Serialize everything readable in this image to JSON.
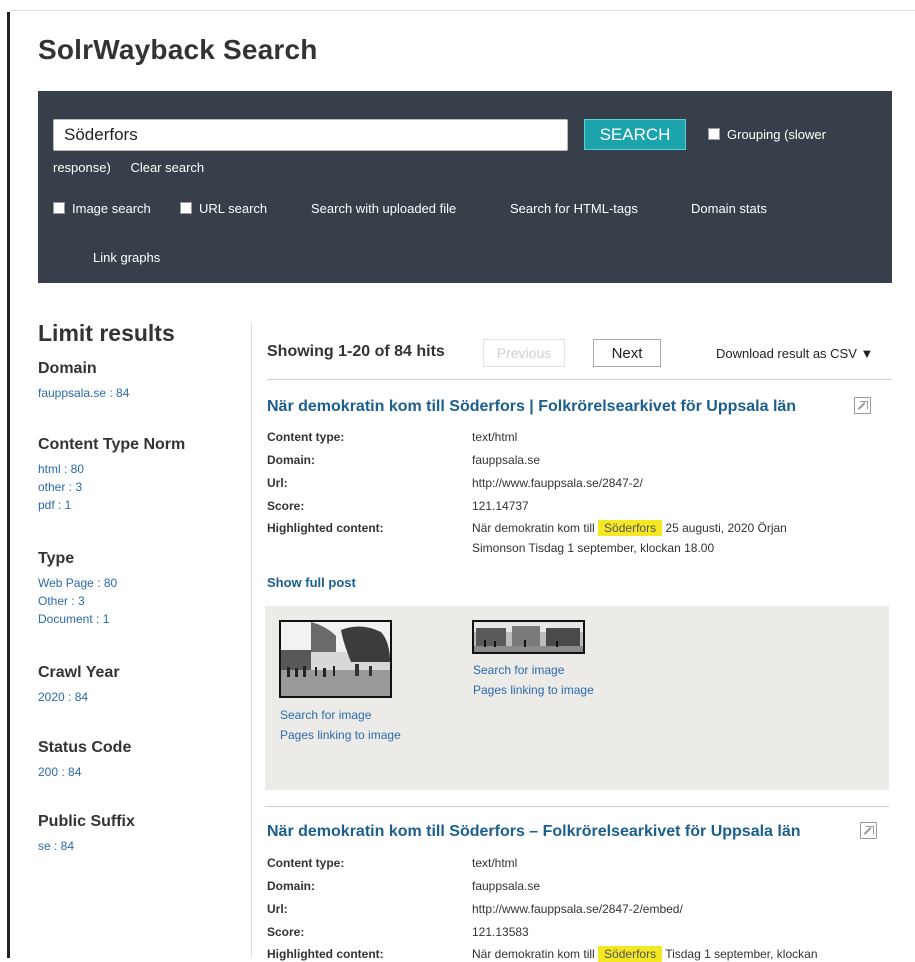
{
  "page": {
    "title": "SolrWayback Search"
  },
  "search": {
    "query": "Söderfors",
    "button_label": "SEARCH",
    "grouping_label": "Grouping (slower",
    "grouping_label_cont": "response)",
    "clear_label": "Clear search",
    "image_search_label": "Image search",
    "url_search_label": "URL search",
    "upload_label": "Search with uploaded file",
    "html_tags_label": "Search for HTML-tags",
    "domain_stats_label": "Domain stats",
    "link_graphs_label": "Link graphs"
  },
  "sidebar": {
    "title": "Limit results",
    "facets": [
      {
        "name": "Domain",
        "values": [
          "fauppsala.se : 84"
        ]
      },
      {
        "name": "Content Type Norm",
        "values": [
          "html : 80",
          "other : 3",
          "pdf : 1"
        ]
      },
      {
        "name": "Type",
        "values": [
          "Web Page : 80",
          "Other : 3",
          "Document : 1"
        ]
      },
      {
        "name": "Crawl Year",
        "values": [
          "2020 : 84"
        ]
      },
      {
        "name": "Status Code",
        "values": [
          "200 : 84"
        ]
      },
      {
        "name": "Public Suffix",
        "values": [
          "se : 84"
        ]
      }
    ]
  },
  "results_header": {
    "showing": "Showing 1-20 of 84 hits",
    "previous_label": "Previous",
    "next_label": "Next",
    "csv_label": "Download result as CSV ▼"
  },
  "labels": {
    "content_type": "Content type:",
    "domain": "Domain:",
    "url": "Url:",
    "score": "Score:",
    "highlighted": "Highlighted content:",
    "show_full_post": "Show full post",
    "search_for_image": "Search for image",
    "pages_linking": "Pages linking to image"
  },
  "results": [
    {
      "title": "När demokratin kom till Söderfors | Folkrörelsearkivet för Uppsala län",
      "content_type": "text/html",
      "domain": "fauppsala.se",
      "url": "http://www.fauppsala.se/2847-2/",
      "score": "121.14737",
      "hl_before": "När demokratin kom till",
      "hl_term": "Söderfors",
      "hl_after": "25 augusti, 2020 Örjan",
      "hl_line2": "Simonson   Tisdag  1 september, klockan 18.00"
    },
    {
      "title": "När demokratin kom till Söderfors – Folkrörelsearkivet för Uppsala län",
      "content_type": "text/html",
      "domain": "fauppsala.se",
      "url": "http://www.fauppsala.se/2847-2/embed/",
      "score": "121.13583",
      "hl_before": "När demokratin kom till",
      "hl_term": "Söderfors",
      "hl_after": "  Tisdag  1 september, klockan"
    }
  ]
}
